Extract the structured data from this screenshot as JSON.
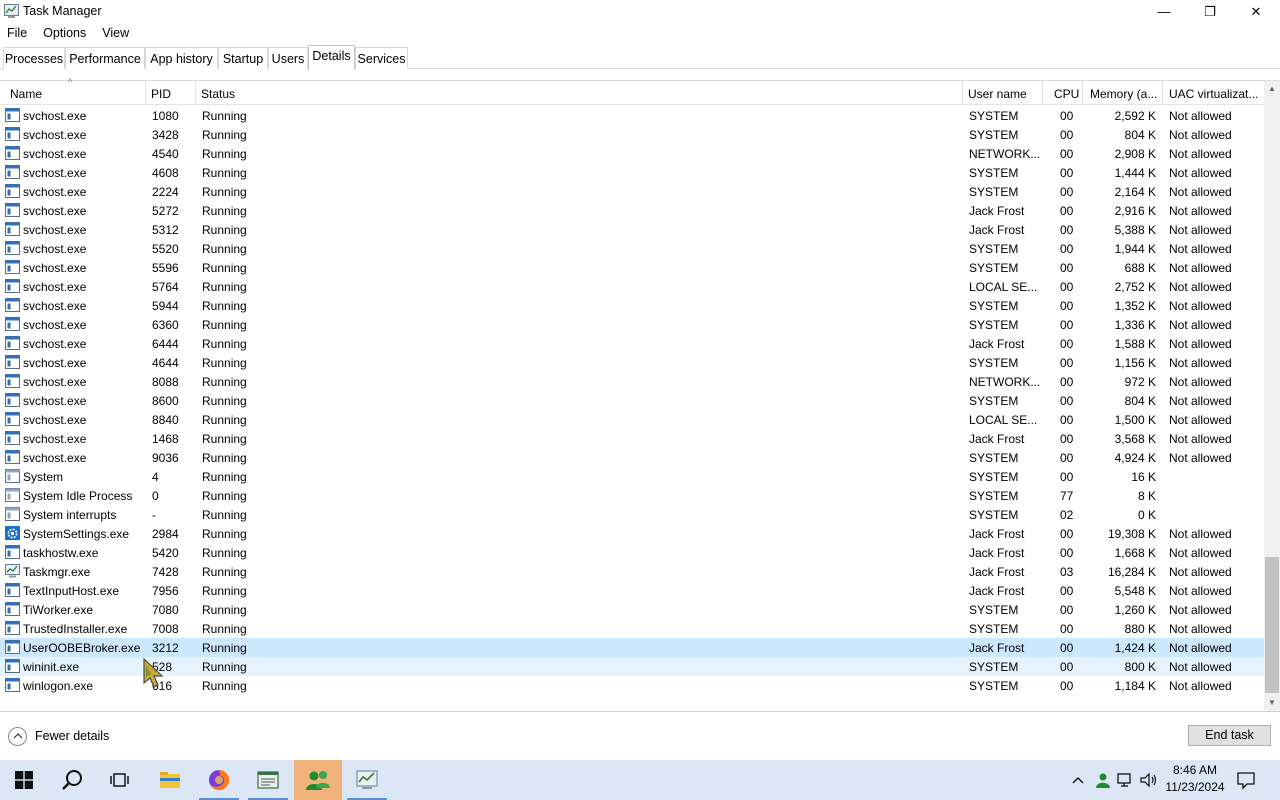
{
  "window": {
    "title": "Task Manager",
    "controls": {
      "minimize": "—",
      "maximize": "❐",
      "close": "✕"
    }
  },
  "menu": [
    "File",
    "Options",
    "View"
  ],
  "tabs": [
    "Processes",
    "Performance",
    "App history",
    "Startup",
    "Users",
    "Details",
    "Services"
  ],
  "active_tab": "Details",
  "columns": {
    "name": "Name",
    "pid": "PID",
    "status": "Status",
    "user": "User name",
    "cpu": "CPU",
    "memory": "Memory (a...",
    "uac": "UAC virtualizat..."
  },
  "sort_indicator": "^",
  "processes": [
    {
      "name": "svchost.exe",
      "pid": "1080",
      "status": "Running",
      "user": "SYSTEM",
      "cpu": "00",
      "memory": "2,592 K",
      "uac": "Not allowed",
      "icon": "service-icon"
    },
    {
      "name": "svchost.exe",
      "pid": "3428",
      "status": "Running",
      "user": "SYSTEM",
      "cpu": "00",
      "memory": "804 K",
      "uac": "Not allowed",
      "icon": "service-icon"
    },
    {
      "name": "svchost.exe",
      "pid": "4540",
      "status": "Running",
      "user": "NETWORK...",
      "cpu": "00",
      "memory": "2,908 K",
      "uac": "Not allowed",
      "icon": "service-icon"
    },
    {
      "name": "svchost.exe",
      "pid": "4608",
      "status": "Running",
      "user": "SYSTEM",
      "cpu": "00",
      "memory": "1,444 K",
      "uac": "Not allowed",
      "icon": "service-icon"
    },
    {
      "name": "svchost.exe",
      "pid": "2224",
      "status": "Running",
      "user": "SYSTEM",
      "cpu": "00",
      "memory": "2,164 K",
      "uac": "Not allowed",
      "icon": "service-icon"
    },
    {
      "name": "svchost.exe",
      "pid": "5272",
      "status": "Running",
      "user": "Jack Frost",
      "cpu": "00",
      "memory": "2,916 K",
      "uac": "Not allowed",
      "icon": "service-icon"
    },
    {
      "name": "svchost.exe",
      "pid": "5312",
      "status": "Running",
      "user": "Jack Frost",
      "cpu": "00",
      "memory": "5,388 K",
      "uac": "Not allowed",
      "icon": "service-icon"
    },
    {
      "name": "svchost.exe",
      "pid": "5520",
      "status": "Running",
      "user": "SYSTEM",
      "cpu": "00",
      "memory": "1,944 K",
      "uac": "Not allowed",
      "icon": "service-icon"
    },
    {
      "name": "svchost.exe",
      "pid": "5596",
      "status": "Running",
      "user": "SYSTEM",
      "cpu": "00",
      "memory": "688 K",
      "uac": "Not allowed",
      "icon": "service-icon"
    },
    {
      "name": "svchost.exe",
      "pid": "5764",
      "status": "Running",
      "user": "LOCAL SE...",
      "cpu": "00",
      "memory": "2,752 K",
      "uac": "Not allowed",
      "icon": "service-icon"
    },
    {
      "name": "svchost.exe",
      "pid": "5944",
      "status": "Running",
      "user": "SYSTEM",
      "cpu": "00",
      "memory": "1,352 K",
      "uac": "Not allowed",
      "icon": "service-icon"
    },
    {
      "name": "svchost.exe",
      "pid": "6360",
      "status": "Running",
      "user": "SYSTEM",
      "cpu": "00",
      "memory": "1,336 K",
      "uac": "Not allowed",
      "icon": "service-icon"
    },
    {
      "name": "svchost.exe",
      "pid": "6444",
      "status": "Running",
      "user": "Jack Frost",
      "cpu": "00",
      "memory": "1,588 K",
      "uac": "Not allowed",
      "icon": "service-icon"
    },
    {
      "name": "svchost.exe",
      "pid": "4644",
      "status": "Running",
      "user": "SYSTEM",
      "cpu": "00",
      "memory": "1,156 K",
      "uac": "Not allowed",
      "icon": "service-icon"
    },
    {
      "name": "svchost.exe",
      "pid": "8088",
      "status": "Running",
      "user": "NETWORK...",
      "cpu": "00",
      "memory": "972 K",
      "uac": "Not allowed",
      "icon": "service-icon"
    },
    {
      "name": "svchost.exe",
      "pid": "8600",
      "status": "Running",
      "user": "SYSTEM",
      "cpu": "00",
      "memory": "804 K",
      "uac": "Not allowed",
      "icon": "service-icon"
    },
    {
      "name": "svchost.exe",
      "pid": "8840",
      "status": "Running",
      "user": "LOCAL SE...",
      "cpu": "00",
      "memory": "1,500 K",
      "uac": "Not allowed",
      "icon": "service-icon"
    },
    {
      "name": "svchost.exe",
      "pid": "1468",
      "status": "Running",
      "user": "Jack Frost",
      "cpu": "00",
      "memory": "3,568 K",
      "uac": "Not allowed",
      "icon": "service-icon"
    },
    {
      "name": "svchost.exe",
      "pid": "9036",
      "status": "Running",
      "user": "SYSTEM",
      "cpu": "00",
      "memory": "4,924 K",
      "uac": "Not allowed",
      "icon": "service-icon"
    },
    {
      "name": "System",
      "pid": "4",
      "status": "Running",
      "user": "SYSTEM",
      "cpu": "00",
      "memory": "16 K",
      "uac": "",
      "icon": "system-window-icon"
    },
    {
      "name": "System Idle Process",
      "pid": "0",
      "status": "Running",
      "user": "SYSTEM",
      "cpu": "77",
      "memory": "8 K",
      "uac": "",
      "icon": "system-window-icon"
    },
    {
      "name": "System interrupts",
      "pid": "-",
      "status": "Running",
      "user": "SYSTEM",
      "cpu": "02",
      "memory": "0 K",
      "uac": "",
      "icon": "system-window-icon"
    },
    {
      "name": "SystemSettings.exe",
      "pid": "2984",
      "status": "Running",
      "user": "Jack Frost",
      "cpu": "00",
      "memory": "19,308 K",
      "uac": "Not allowed",
      "icon": "settings-gear-icon"
    },
    {
      "name": "taskhostw.exe",
      "pid": "5420",
      "status": "Running",
      "user": "Jack Frost",
      "cpu": "00",
      "memory": "1,668 K",
      "uac": "Not allowed",
      "icon": "service-icon"
    },
    {
      "name": "Taskmgr.exe",
      "pid": "7428",
      "status": "Running",
      "user": "Jack Frost",
      "cpu": "03",
      "memory": "16,284 K",
      "uac": "Not allowed",
      "icon": "task-manager-icon"
    },
    {
      "name": "TextInputHost.exe",
      "pid": "7956",
      "status": "Running",
      "user": "Jack Frost",
      "cpu": "00",
      "memory": "5,548 K",
      "uac": "Not allowed",
      "icon": "service-icon"
    },
    {
      "name": "TiWorker.exe",
      "pid": "7080",
      "status": "Running",
      "user": "SYSTEM",
      "cpu": "00",
      "memory": "1,260 K",
      "uac": "Not allowed",
      "icon": "service-icon"
    },
    {
      "name": "TrustedInstaller.exe",
      "pid": "7008",
      "status": "Running",
      "user": "SYSTEM",
      "cpu": "00",
      "memory": "880 K",
      "uac": "Not allowed",
      "icon": "service-icon"
    },
    {
      "name": "UserOOBEBroker.exe",
      "pid": "3212",
      "status": "Running",
      "user": "Jack Frost",
      "cpu": "00",
      "memory": "1,424 K",
      "uac": "Not allowed",
      "icon": "service-icon",
      "state": "selected"
    },
    {
      "name": "wininit.exe",
      "pid": "528",
      "status": "Running",
      "user": "SYSTEM",
      "cpu": "00",
      "memory": "800 K",
      "uac": "Not allowed",
      "icon": "service-icon",
      "state": "hover"
    },
    {
      "name": "winlogon.exe",
      "pid": "616",
      "status": "Running",
      "user": "SYSTEM",
      "cpu": "00",
      "memory": "1,184 K",
      "uac": "Not allowed",
      "icon": "service-icon"
    }
  ],
  "footer": {
    "fewer_details": "Fewer details",
    "end_task": "End task"
  },
  "taskbar": {
    "apps": [
      "start-icon",
      "search-icon",
      "task-view-icon",
      "file-explorer-icon",
      "firefox-icon",
      "notepad-icon",
      "people-app-icon",
      "task-manager-icon"
    ],
    "clock_time": "8:46 AM",
    "clock_date": "11/23/2024"
  },
  "colors": {
    "selected_row": "#cce8ff",
    "hover_row": "#e5f3ff",
    "taskbar": "#dbe7f5",
    "active_taskbar_button": "#f2b27c"
  }
}
